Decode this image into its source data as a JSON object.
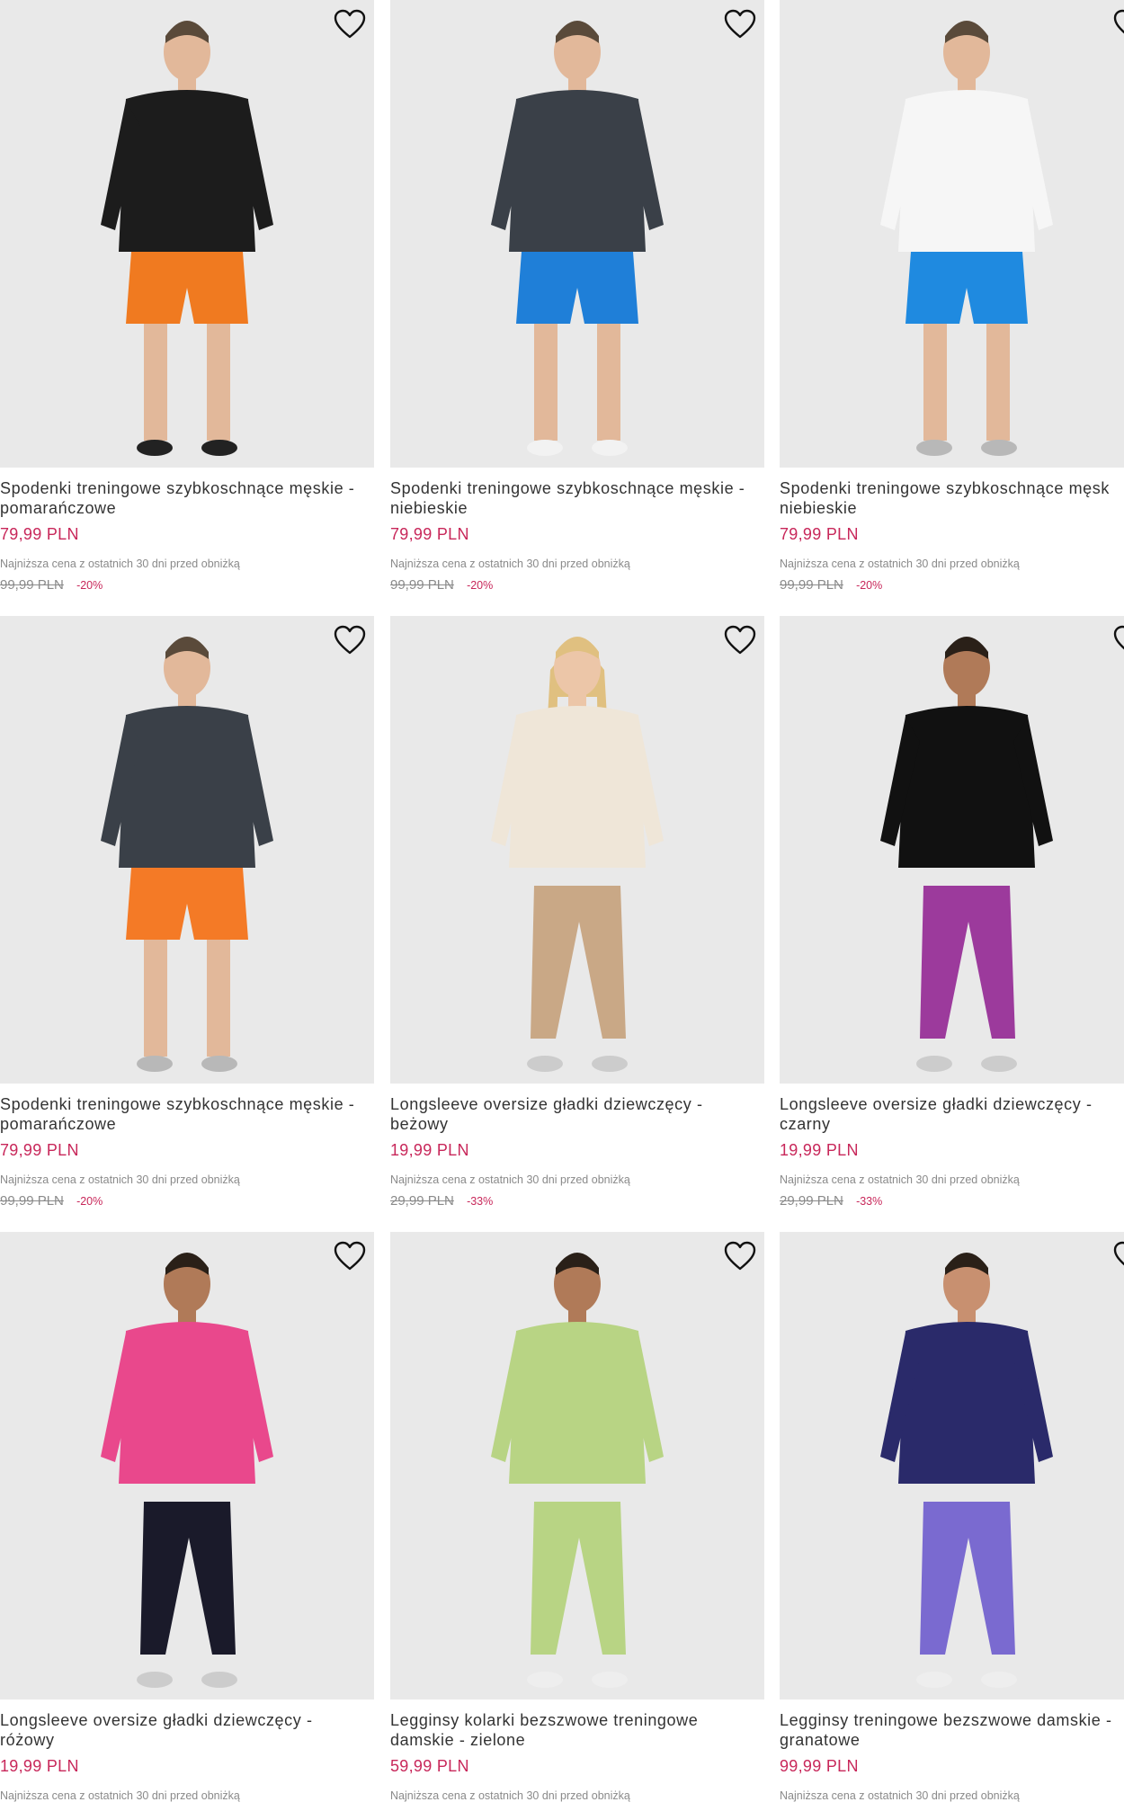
{
  "products": [
    {
      "title_line1": "Spodenki treningowe szybkoschnące męskie -",
      "title_line2": "pomarańczowe",
      "price": "79,99 PLN",
      "lowest_price_note": "Najniższa cena z ostatnich 30 dni przed obniżką",
      "old_price": "99,99 PLN",
      "discount": "-20%",
      "colors": {
        "top": "#1c1c1c",
        "bottom": "#f07a20",
        "skin": "#e2b89a",
        "hair": "#5a4a3a",
        "shoes": "#222222"
      },
      "wishlist_icon": "heart-outline-icon"
    },
    {
      "title_line1": "Spodenki treningowe szybkoschnące męskie -",
      "title_line2": "niebieskie",
      "price": "79,99 PLN",
      "lowest_price_note": "Najniższa cena z ostatnich 30 dni przed obniżką",
      "old_price": "99,99 PLN",
      "discount": "-20%",
      "colors": {
        "top": "#3a4048",
        "bottom": "#1f7fd8",
        "skin": "#e2b89a",
        "hair": "#5a4a3a",
        "shoes": "#f2f2f2"
      },
      "wishlist_icon": "heart-outline-icon"
    },
    {
      "title_line1": "Spodenki treningowe szybkoschnące męsk",
      "title_line2": "niebieskie",
      "price": "79,99 PLN",
      "lowest_price_note": "Najniższa cena z ostatnich 30 dni przed obniżką",
      "old_price": "99,99 PLN",
      "discount": "-20%",
      "colors": {
        "top": "#f6f6f6",
        "bottom": "#1f8ae0",
        "skin": "#e2b89a",
        "hair": "#5a4a3a",
        "shoes": "#b8b8b8"
      },
      "wishlist_icon": "heart-outline-icon"
    },
    {
      "title_line1": "Spodenki treningowe szybkoschnące męskie -",
      "title_line2": "pomarańczowe",
      "price": "79,99 PLN",
      "lowest_price_note": "Najniższa cena z ostatnich 30 dni przed obniżką",
      "old_price": "99,99 PLN",
      "discount": "-20%",
      "colors": {
        "top": "#3a4048",
        "bottom": "#f47a26",
        "skin": "#e2b89a",
        "hair": "#5a4a3a",
        "shoes": "#b8b8b8"
      },
      "wishlist_icon": "heart-outline-icon"
    },
    {
      "title_line1": "Longsleeve oversize gładki dziewczęcy -",
      "title_line2": "beżowy",
      "price": "19,99 PLN",
      "lowest_price_note": "Najniższa cena z ostatnich 30 dni przed obniżką",
      "old_price": "29,99 PLN",
      "discount": "-33%",
      "colors": {
        "top": "#efe6d8",
        "bottom": "#c9a886",
        "skin": "#ecc6a8",
        "hair": "#e0c080",
        "shoes": "#cccccc"
      },
      "wishlist_icon": "heart-outline-icon"
    },
    {
      "title_line1": "Longsleeve oversize gładki dziewczęcy -",
      "title_line2": "czarny",
      "price": "19,99 PLN",
      "lowest_price_note": "Najniższa cena z ostatnich 30 dni przed obniżką",
      "old_price": "29,99 PLN",
      "discount": "-33%",
      "colors": {
        "top": "#111111",
        "bottom": "#9c3a9c",
        "skin": "#b07a58",
        "hair": "#2a2018",
        "shoes": "#cccccc"
      },
      "wishlist_icon": "heart-outline-icon"
    },
    {
      "title_line1": "Longsleeve oversize gładki dziewczęcy -",
      "title_line2": "różowy",
      "price": "19,99 PLN",
      "lowest_price_note": "Najniższa cena z ostatnich 30 dni przed obniżką",
      "old_price": "",
      "discount": "",
      "colors": {
        "top": "#e9488c",
        "bottom": "#1a1a2a",
        "skin": "#b07a58",
        "hair": "#2a2018",
        "shoes": "#cccccc"
      },
      "wishlist_icon": "heart-outline-icon"
    },
    {
      "title_line1": "Legginsy kolarki bezszwowe treningowe",
      "title_line2": "damskie - zielone",
      "price": "59,99 PLN",
      "lowest_price_note": "Najniższa cena z ostatnich 30 dni przed obniżką",
      "old_price": "",
      "discount": "",
      "colors": {
        "top": "#b8d484",
        "bottom": "#b8d484",
        "skin": "#b07a58",
        "hair": "#2a2018",
        "shoes": "#eeeeee"
      },
      "wishlist_icon": "heart-outline-icon"
    },
    {
      "title_line1": "Legginsy treningowe bezszwowe damskie -",
      "title_line2": "granatowe",
      "price": "99,99 PLN",
      "lowest_price_note": "Najniższa cena z ostatnich 30 dni przed obniżką",
      "old_price": "",
      "discount": "",
      "colors": {
        "top": "#2a2a6a",
        "bottom": "#7a6ad0",
        "skin": "#c89070",
        "hair": "#2a2018",
        "shoes": "#eeeeee"
      },
      "wishlist_icon": "heart-outline-icon"
    }
  ]
}
